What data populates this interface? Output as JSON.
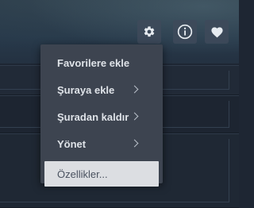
{
  "toolbar": {
    "gear_icon": "gear-icon",
    "info_icon": "info-icon",
    "heart_icon": "heart-icon"
  },
  "context_menu": {
    "items": [
      {
        "label": "Favorilere ekle",
        "has_submenu": false
      },
      {
        "label": "Şuraya ekle",
        "has_submenu": true
      },
      {
        "label": "Şuradan kaldır",
        "has_submenu": true
      },
      {
        "label": "Yönet",
        "has_submenu": true
      },
      {
        "label": "Özellikler...",
        "has_submenu": false,
        "highlighted": true
      }
    ]
  },
  "colors": {
    "menu_background": "#3d4450",
    "menu_text": "#dfe3e8",
    "highlight_background": "#dcdee2",
    "page_background": "#1e2633"
  }
}
